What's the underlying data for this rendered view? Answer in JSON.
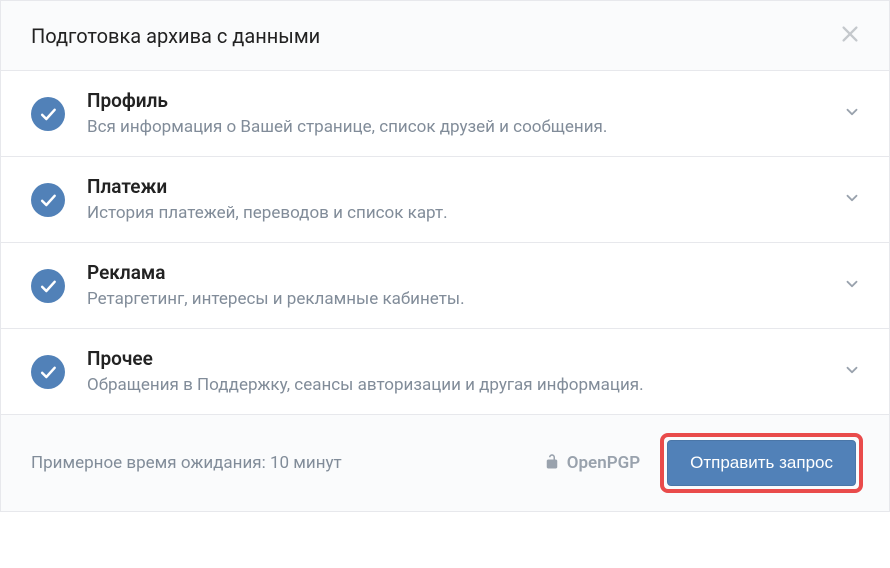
{
  "dialog": {
    "title": "Подготовка архива с данными"
  },
  "options": [
    {
      "title": "Профиль",
      "desc": "Вся информация о Вашей странице, список друзей и сообщения."
    },
    {
      "title": "Платежи",
      "desc": "История платежей, переводов и список карт."
    },
    {
      "title": "Реклама",
      "desc": "Ретаргетинг, интересы и рекламные кабинеты."
    },
    {
      "title": "Прочее",
      "desc": "Обращения в Поддержку, сеансы авторизации и другая информация."
    }
  ],
  "footer": {
    "wait_text": "Примерное время ожидания: 10 минут",
    "pgp_label": "OpenPGP",
    "submit_label": "Отправить запрос"
  }
}
